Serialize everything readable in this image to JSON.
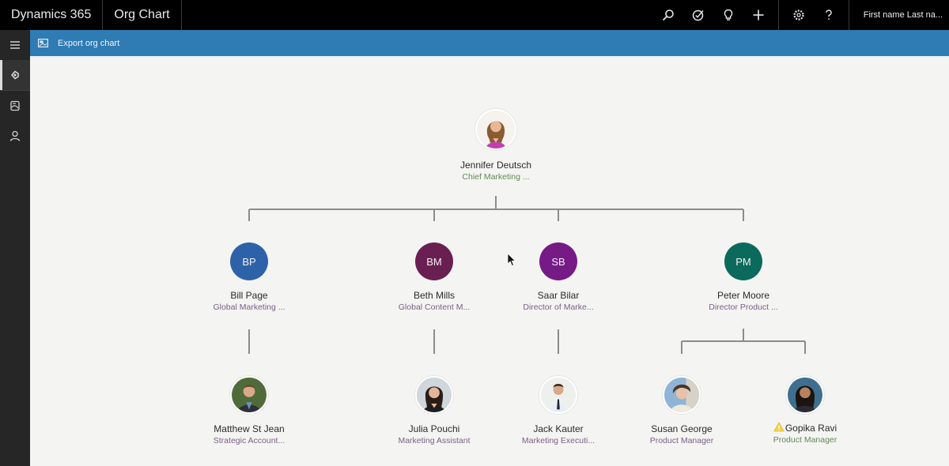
{
  "topbar": {
    "brand": "Dynamics 365",
    "app_name": "Org Chart",
    "icons": [
      "search-icon",
      "task-icon",
      "lightbulb-icon",
      "add-icon",
      "settings-icon",
      "help-icon"
    ],
    "user": "First name Last na..."
  },
  "rail": {
    "items": [
      "org-chart-icon",
      "contact-card-icon",
      "person-icon"
    ]
  },
  "commandbar": {
    "export_label": "Export org chart"
  },
  "colors": {
    "topbar": "#000000",
    "commandbar": "#2f7bb3",
    "canvas": "#f4f4f2",
    "rail": "#262626"
  },
  "org": {
    "root": {
      "name": "Jennifer Deutsch",
      "title": "Chief Marketing ...",
      "avatar": "photo"
    },
    "level1": [
      {
        "initials": "BP",
        "name": "Bill Page",
        "title": "Global Marketing ...",
        "color": "#2e62a8"
      },
      {
        "initials": "BM",
        "name": "Beth Mills",
        "title": "Global Content M...",
        "color": "#6a1f52"
      },
      {
        "initials": "SB",
        "name": "Saar Bilar",
        "title": "Director of Marke...",
        "color": "#761a86"
      },
      {
        "initials": "PM",
        "name": "Peter Moore",
        "title": "Director Product ...",
        "color": "#0b6a5c"
      }
    ],
    "level2": [
      {
        "name": "Matthew St Jean",
        "title": "Strategic Account...",
        "manager": "Bill Page",
        "avatar": "photo"
      },
      {
        "name": "Julia Pouchi",
        "title": "Marketing Assistant",
        "manager": "Beth Mills",
        "avatar": "photo"
      },
      {
        "name": "Jack Kauter",
        "title": "Marketing Executi...",
        "manager": "Saar Bilar",
        "avatar": "photo"
      },
      {
        "name": "Susan George",
        "title": "Product Manager",
        "manager": "Peter Moore",
        "avatar": "photo"
      },
      {
        "name": "Gopika Ravi",
        "title": "Product Manager",
        "manager": "Peter Moore",
        "avatar": "photo",
        "warning": true
      }
    ]
  }
}
